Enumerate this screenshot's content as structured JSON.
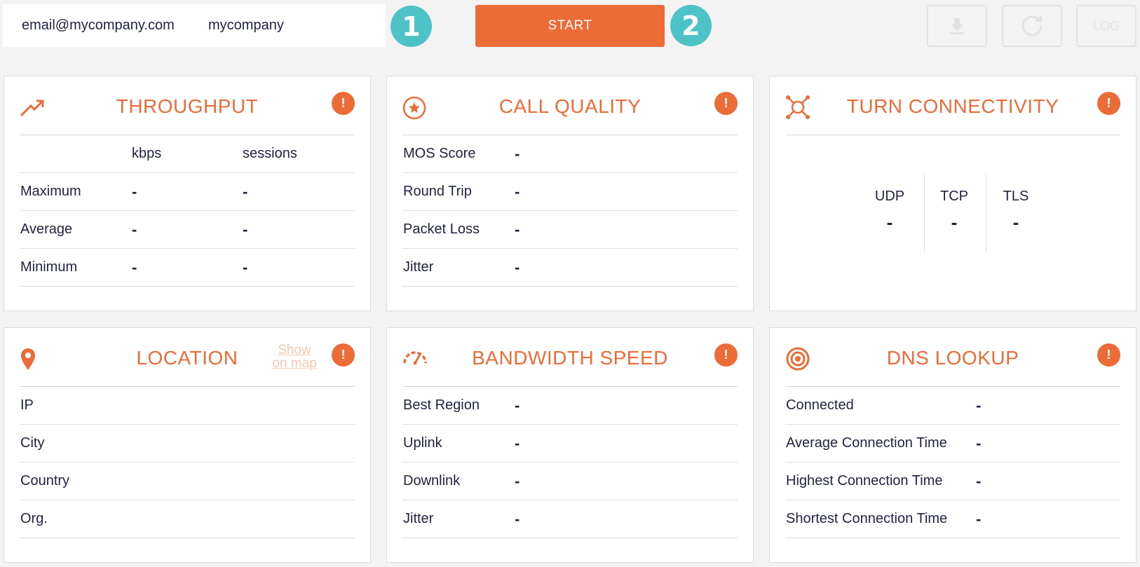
{
  "header": {
    "email_value": "email@mycompany.com",
    "company_value": "mycompany",
    "step1": "1",
    "step2": "2",
    "start_label": "START",
    "log_label": "LOG"
  },
  "colors": {
    "accent": "#ec6c37",
    "step": "#4dc3c8",
    "text": "#1f2340"
  },
  "throughput": {
    "title": "THROUGHPUT",
    "col_kbps": "kbps",
    "col_sessions": "sessions",
    "rows": [
      {
        "label": "Maximum",
        "kbps": "-",
        "sessions": "-"
      },
      {
        "label": "Average",
        "kbps": "-",
        "sessions": "-"
      },
      {
        "label": "Minimum",
        "kbps": "-",
        "sessions": "-"
      }
    ]
  },
  "call_quality": {
    "title": "CALL QUALITY",
    "rows": [
      {
        "label": "MOS Score",
        "value": "-"
      },
      {
        "label": "Round Trip",
        "value": "-"
      },
      {
        "label": "Packet Loss",
        "value": "-"
      },
      {
        "label": "Jitter",
        "value": "-"
      }
    ]
  },
  "turn": {
    "title": "TURN CONNECTIVITY",
    "cols": [
      {
        "label": "UDP",
        "value": "-"
      },
      {
        "label": "TCP",
        "value": "-"
      },
      {
        "label": "TLS",
        "value": "-"
      }
    ]
  },
  "location": {
    "title": "LOCATION",
    "map_line1": "Show",
    "map_line2": "on map",
    "rows": [
      {
        "label": "IP"
      },
      {
        "label": "City"
      },
      {
        "label": "Country"
      },
      {
        "label": "Org."
      }
    ]
  },
  "bandwidth": {
    "title": "BANDWIDTH SPEED",
    "rows": [
      {
        "label": "Best Region",
        "value": "-"
      },
      {
        "label": "Uplink",
        "value": "-"
      },
      {
        "label": "Downlink",
        "value": "-"
      },
      {
        "label": "Jitter",
        "value": "-"
      }
    ]
  },
  "dns": {
    "title": "DNS LOOKUP",
    "rows": [
      {
        "label": "Connected",
        "value": "-"
      },
      {
        "label": "Average Connection Time",
        "value": "-"
      },
      {
        "label": "Highest Connection Time",
        "value": "-"
      },
      {
        "label": "Shortest Connection Time",
        "value": "-"
      }
    ]
  },
  "warn_glyph": "!"
}
